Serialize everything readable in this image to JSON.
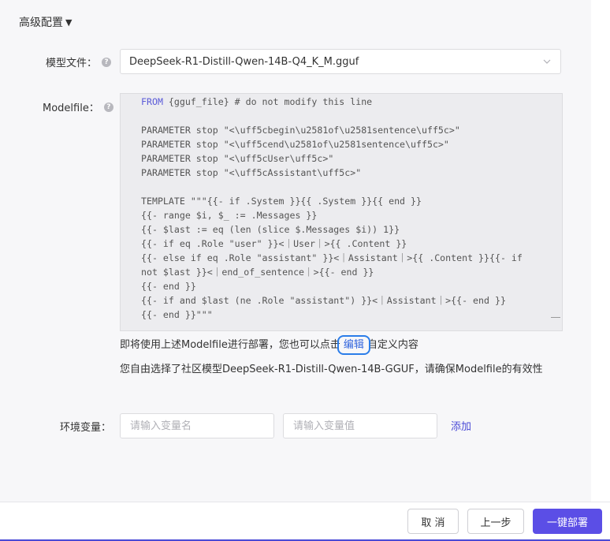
{
  "advanced": {
    "title": "高级配置",
    "caret": "▼"
  },
  "model_file": {
    "label": "模型文件：",
    "value": "DeepSeek-R1-Distill-Qwen-14B-Q4_K_M.gguf"
  },
  "modelfile": {
    "label": "Modelfile：",
    "lines": [
      "FROM {gguf_file} # do not modify this line",
      "",
      "PARAMETER stop \"<\\uff5cbegin\\u2581of\\u2581sentence\\uff5c>\"",
      "PARAMETER stop \"<\\uff5cend\\u2581of\\u2581sentence\\uff5c>\"",
      "PARAMETER stop \"<\\uff5cUser\\uff5c>\"",
      "PARAMETER stop \"<\\uff5cAssistant\\uff5c>\"",
      "",
      "TEMPLATE \"\"\"{{- if .System }}{{ .System }}{{ end }}",
      "{{- range $i, $_ := .Messages }}",
      "{{- $last := eq (len (slice $.Messages $i)) 1}}",
      "{{- if eq .Role \"user\" }}<｜User｜>{{ .Content }}",
      "{{- else if eq .Role \"assistant\" }}<｜Assistant｜>{{ .Content }}{{- if",
      "not $last }}<｜end_of_sentence｜>{{- end }}",
      "{{- end }}",
      "{{- if and $last (ne .Role \"assistant\") }}<｜Assistant｜>{{- end }}",
      "{{- end }}\"\"\""
    ]
  },
  "hint": {
    "before": "即将使用上述Modelfile进行部署，您也可以点击",
    "link": "编辑",
    "after": "自定义内容"
  },
  "community_note": "您自由选择了社区模型DeepSeek-R1-Distill-Qwen-14B-GGUF，请确保Modelfile的有效性",
  "env": {
    "label": "环境变量：",
    "name_placeholder": "请输入变量名",
    "value_placeholder": "请输入变量值",
    "add": "添加"
  },
  "footer": {
    "cancel": "取 消",
    "prev": "上一步",
    "deploy": "一键部署"
  },
  "colors": {
    "primary": "#5b4ee6",
    "link": "#3366dd",
    "panel_bg": "#f7f7f9",
    "code_bg": "#ececef"
  }
}
